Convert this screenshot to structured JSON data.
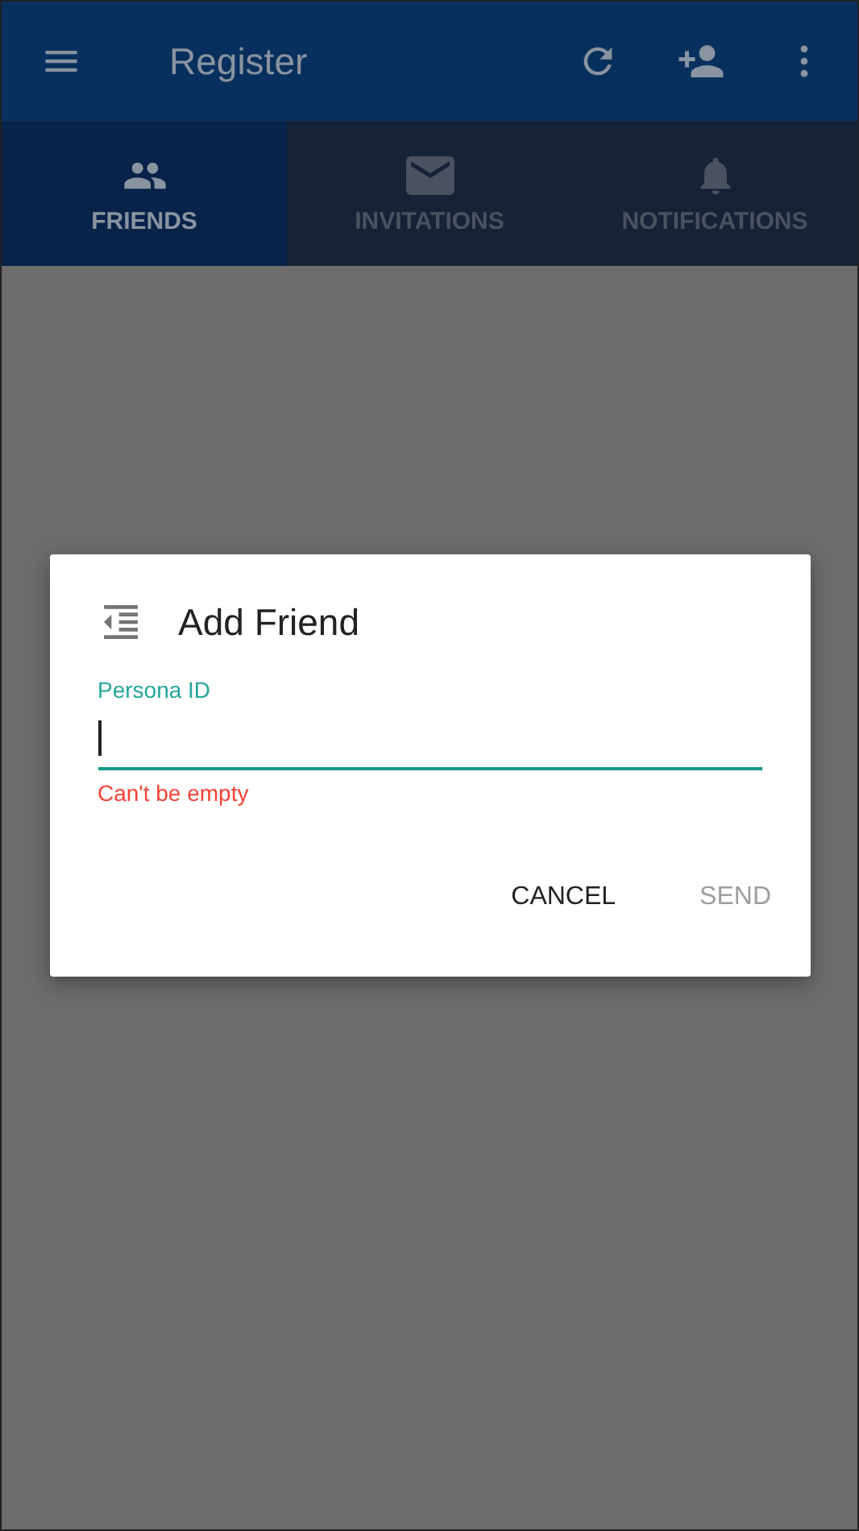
{
  "app_bar": {
    "title": "Register",
    "actions": [
      {
        "kind": "refresh"
      },
      {
        "kind": "add-person"
      },
      {
        "kind": "more"
      }
    ]
  },
  "tabs": [
    {
      "label": "FRIENDS",
      "kind": "people",
      "selected": true
    },
    {
      "label": "INVITATIONS",
      "kind": "mail",
      "selected": false
    },
    {
      "label": "NOTIFICATIONS",
      "kind": "bell",
      "selected": false
    }
  ],
  "dialog": {
    "title": "Add Friend",
    "field": {
      "label": "Persona ID",
      "focused": true,
      "error": "Can't be empty"
    },
    "buttons": [
      {
        "label": "CANCEL",
        "disabled": false
      },
      {
        "label": "SEND",
        "disabled": true
      }
    ]
  }
}
